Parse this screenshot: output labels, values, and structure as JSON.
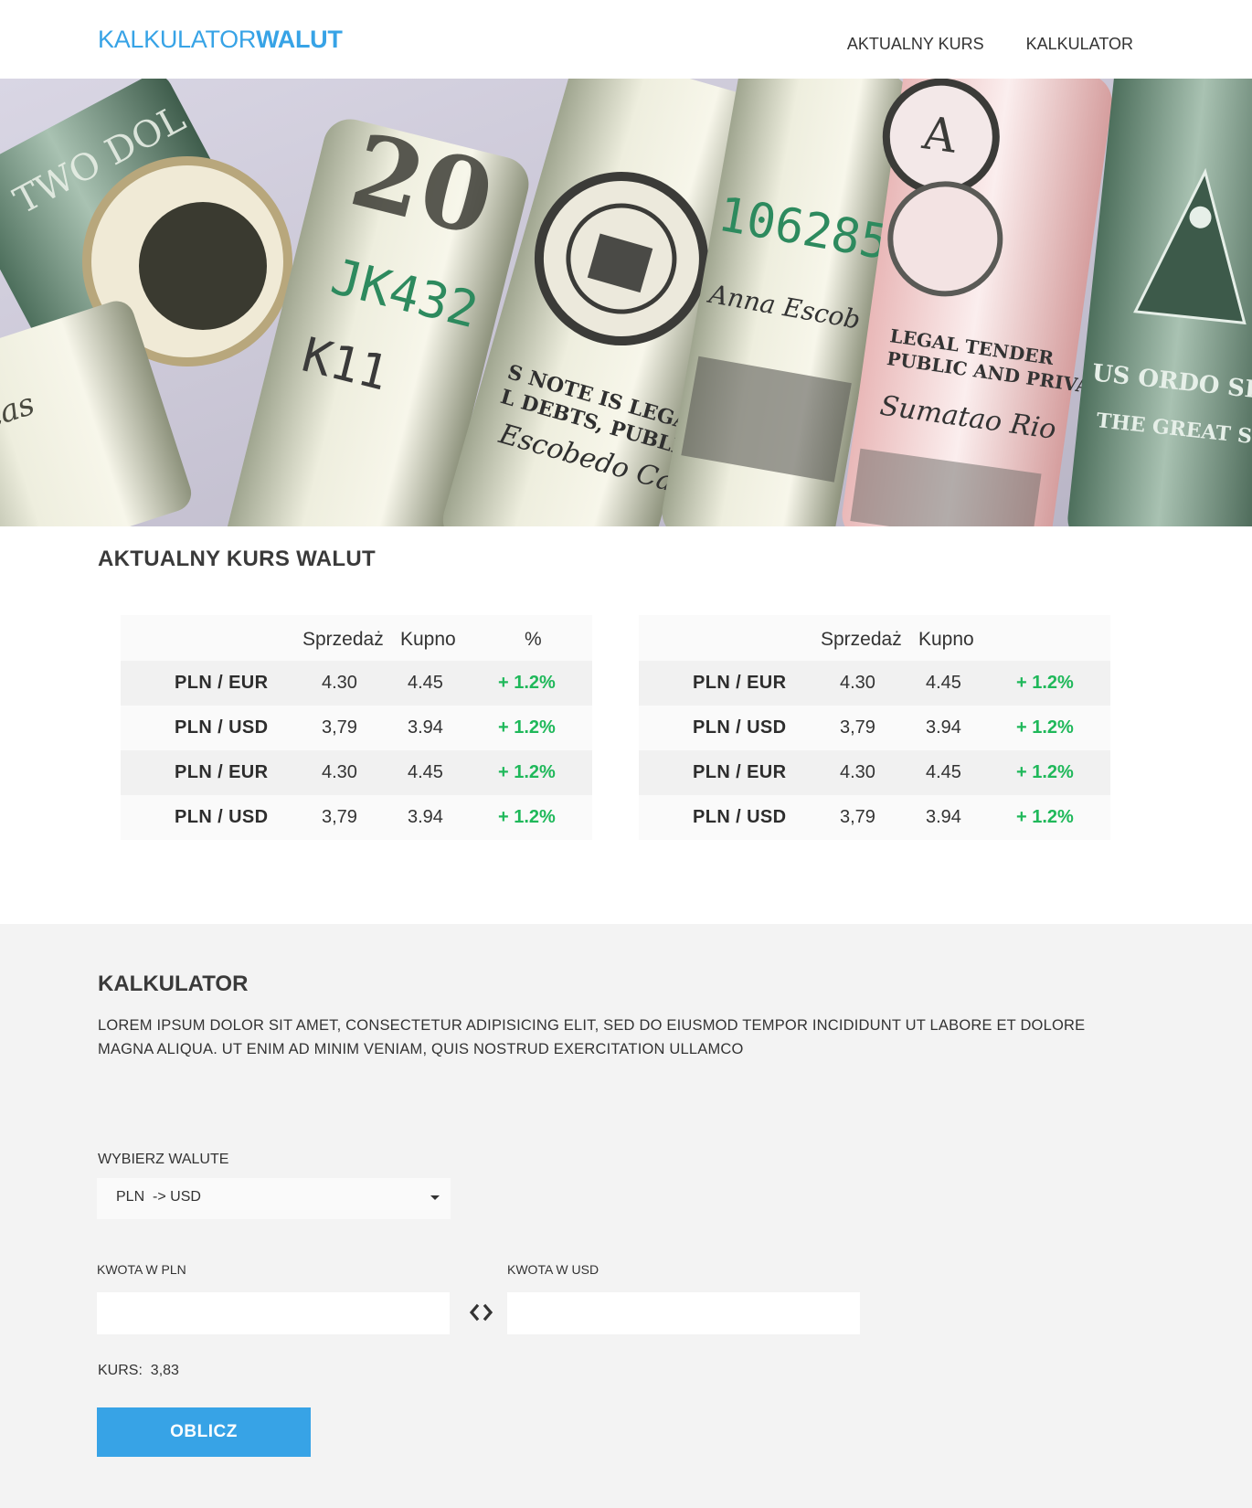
{
  "header": {
    "logo_light": "KALKULATOR",
    "logo_bold": "WALUT",
    "nav": [
      "AKTUALNY KURS",
      "KALKULATOR"
    ]
  },
  "rates": {
    "title": "AKTUALNY KURS WALUT",
    "tables": [
      {
        "headers": {
          "pair": "",
          "sell": "Sprzedaż",
          "buy": "Kupno",
          "pct": "%"
        },
        "rows": [
          {
            "pair": "PLN / EUR",
            "sell": "4.30",
            "buy": "4.45",
            "pct": "+ 1.2%"
          },
          {
            "pair": "PLN / USD",
            "sell": "3,79",
            "buy": "3.94",
            "pct": "+ 1.2%"
          },
          {
            "pair": "PLN / EUR",
            "sell": "4.30",
            "buy": "4.45",
            "pct": "+ 1.2%"
          },
          {
            "pair": "PLN / USD",
            "sell": "3,79",
            "buy": "3.94",
            "pct": "+ 1.2%"
          }
        ]
      },
      {
        "headers": {
          "pair": "",
          "sell": "Sprzedaż",
          "buy": "Kupno",
          "pct": ""
        },
        "rows": [
          {
            "pair": "PLN / EUR",
            "sell": "4.30",
            "buy": "4.45",
            "pct": "+ 1.2%"
          },
          {
            "pair": "PLN / USD",
            "sell": "3,79",
            "buy": "3.94",
            "pct": "+ 1.2%"
          },
          {
            "pair": "PLN / EUR",
            "sell": "4.30",
            "buy": "4.45",
            "pct": "+ 1.2%"
          },
          {
            "pair": "PLN / USD",
            "sell": "3,79",
            "buy": "3.94",
            "pct": "+ 1.2%"
          }
        ]
      }
    ]
  },
  "calculator": {
    "title": "KALKULATOR",
    "description": "LOREM IPSUM DOLOR SIT AMET, CONSECTETUR ADIPISICING ELIT, SED DO EIUSMOD TEMPOR INCIDIDUNT UT LABORE ET DOLORE MAGNA ALIQUA. UT ENIM AD MINIM VENIAM, QUIS NOSTRUD EXERCITATION ULLAMCO",
    "select_label": "WYBIERZ WALUTE",
    "select_value": "PLN  -> USD",
    "label_from": "KWOTA W PLN",
    "label_to": "KWOTA W USD",
    "input_from_value": "",
    "input_to_value": "",
    "rate_text": "KURS:  3,83",
    "button_label": "OBLICZ"
  },
  "colors": {
    "accent": "#37a3e6",
    "positive": "#1fb85a",
    "section_bg": "#f3f3f3"
  },
  "icons": {
    "swap": "swap-arrows-icon",
    "dropdown": "caret-down-icon"
  }
}
